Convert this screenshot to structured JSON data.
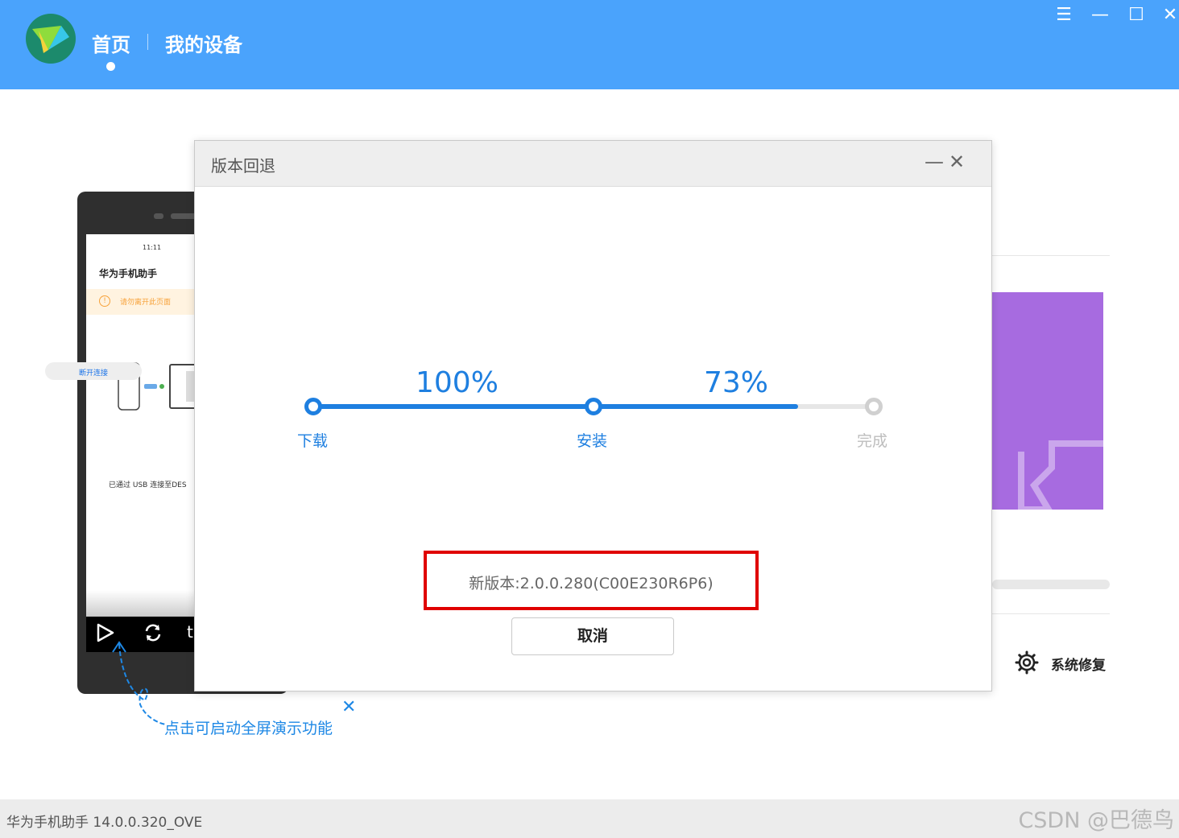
{
  "header": {
    "nav_home": "首页",
    "nav_device": "我的设备",
    "window_controls": [
      "menu-icon",
      "minimize-icon",
      "maximize-icon",
      "close-icon"
    ]
  },
  "phone": {
    "time": "11:11",
    "app_title": "华为手机助手",
    "warning": "请勿离开此页面",
    "usb_status": "已通过 USB 连接至DES",
    "pill_label": "断开连接"
  },
  "hint": {
    "text": "点击可启动全屏演示功能"
  },
  "right_panel": {
    "repair_label": "系统修复"
  },
  "dialog": {
    "title": "版本回退",
    "steps": [
      {
        "label": "下载",
        "state": "done"
      },
      {
        "label": "安装",
        "state": "active"
      },
      {
        "label": "完成",
        "state": "pending"
      }
    ],
    "progress": {
      "download_percent_label": "100%",
      "install_percent_label": "73%",
      "download_fraction": 1.0,
      "install_fraction": 0.73
    },
    "version_text": "新版本:2.0.0.280(C00E230R6P6)",
    "cancel_label": "取消"
  },
  "status": {
    "app_version": "华为手机助手 14.0.0.320_OVE",
    "watermark": "CSDN @巴德鸟"
  },
  "colors": {
    "header_bg": "#4aa3fc",
    "accent": "#1e7fe0",
    "highlight_box": "#e00000",
    "pending": "#bdbdbd"
  }
}
